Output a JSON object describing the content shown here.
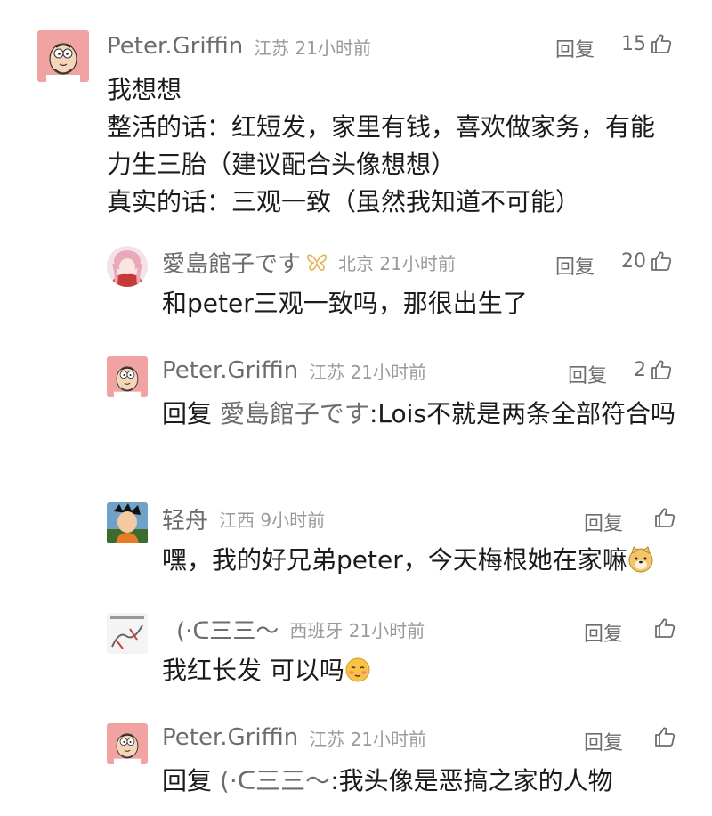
{
  "thread": {
    "reply_label": "回复",
    "comments": [
      {
        "user": "Peter.Griffin",
        "location_time": "江苏 21小时前",
        "likes": "15",
        "body": "我想想\n整活的话：红短发，家里有钱，喜欢做家务，有能力生三胎（建议配合头像想想）\n真实的话：三观一致（虽然我知道不可能）"
      },
      {
        "user": "愛島館子です",
        "location_time": "北京 21小时前",
        "likes": "20",
        "body": "和peter三观一致吗，那很出生了"
      },
      {
        "user": "Peter.Griffin",
        "location_time": "江苏 21小时前",
        "likes": "2",
        "reply_prefix": "回复",
        "reply_to": "愛島館子です",
        "body": ":Lois不就是两条全部符合吗"
      },
      {
        "user": "轻舟",
        "location_time": "江西 9小时前",
        "likes": "",
        "body": "嘿，我的好兄弟peter，今天梅根她在家嘛"
      },
      {
        "user": "(·ᑕ三三～",
        "location_time": "西班牙 21小时前",
        "likes": "",
        "body": "我红长发 可以吗"
      },
      {
        "user": "Peter.Griffin",
        "location_time": "江苏 21小时前",
        "likes": "",
        "reply_prefix": "回复",
        "reply_to": "(·ᑕ三三～",
        "body": ":我头像是恶搞之家的人物"
      }
    ]
  }
}
